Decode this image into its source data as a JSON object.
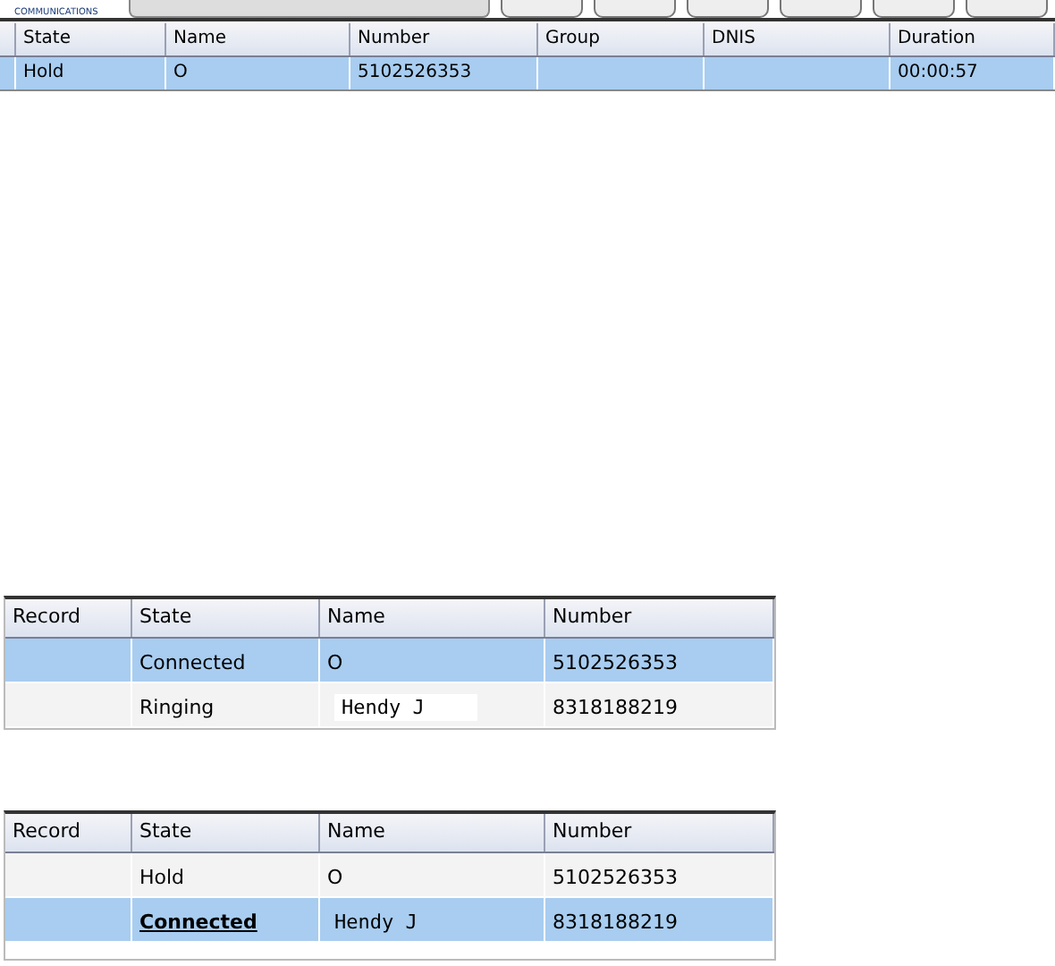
{
  "toolbar": {
    "logo_text": "COMMUNICATIONS"
  },
  "grids": [
    {
      "columns": [
        "",
        "State",
        "Name",
        "Number",
        "Group",
        "DNIS",
        "Duration"
      ],
      "rows": [
        {
          "selected": true,
          "cells": [
            "",
            "Hold",
            "O",
            "5102526353",
            "",
            "",
            "00:00:57"
          ],
          "state_link": false,
          "name_boxed": false,
          "name_typed": false
        }
      ]
    },
    {
      "columns": [
        "Record",
        "State",
        "Name",
        "Number"
      ],
      "rows": [
        {
          "selected": true,
          "cells": [
            "",
            "Connected",
            "O",
            "5102526353"
          ],
          "state_link": false,
          "name_boxed": false,
          "name_typed": false
        },
        {
          "selected": false,
          "cells": [
            "",
            "Ringing",
            "Hendy J",
            "8318188219"
          ],
          "state_link": false,
          "name_boxed": true,
          "name_typed": true
        }
      ]
    },
    {
      "columns": [
        "Record",
        "State",
        "Name",
        "Number"
      ],
      "rows": [
        {
          "selected": false,
          "cells": [
            "",
            "Hold",
            "O",
            "5102526353"
          ],
          "state_link": false,
          "name_boxed": false,
          "name_typed": false
        },
        {
          "selected": true,
          "cells": [
            "",
            "Connected",
            "Hendy J",
            "8318188219"
          ],
          "state_link": true,
          "name_boxed": false,
          "name_typed": true
        }
      ]
    }
  ]
}
